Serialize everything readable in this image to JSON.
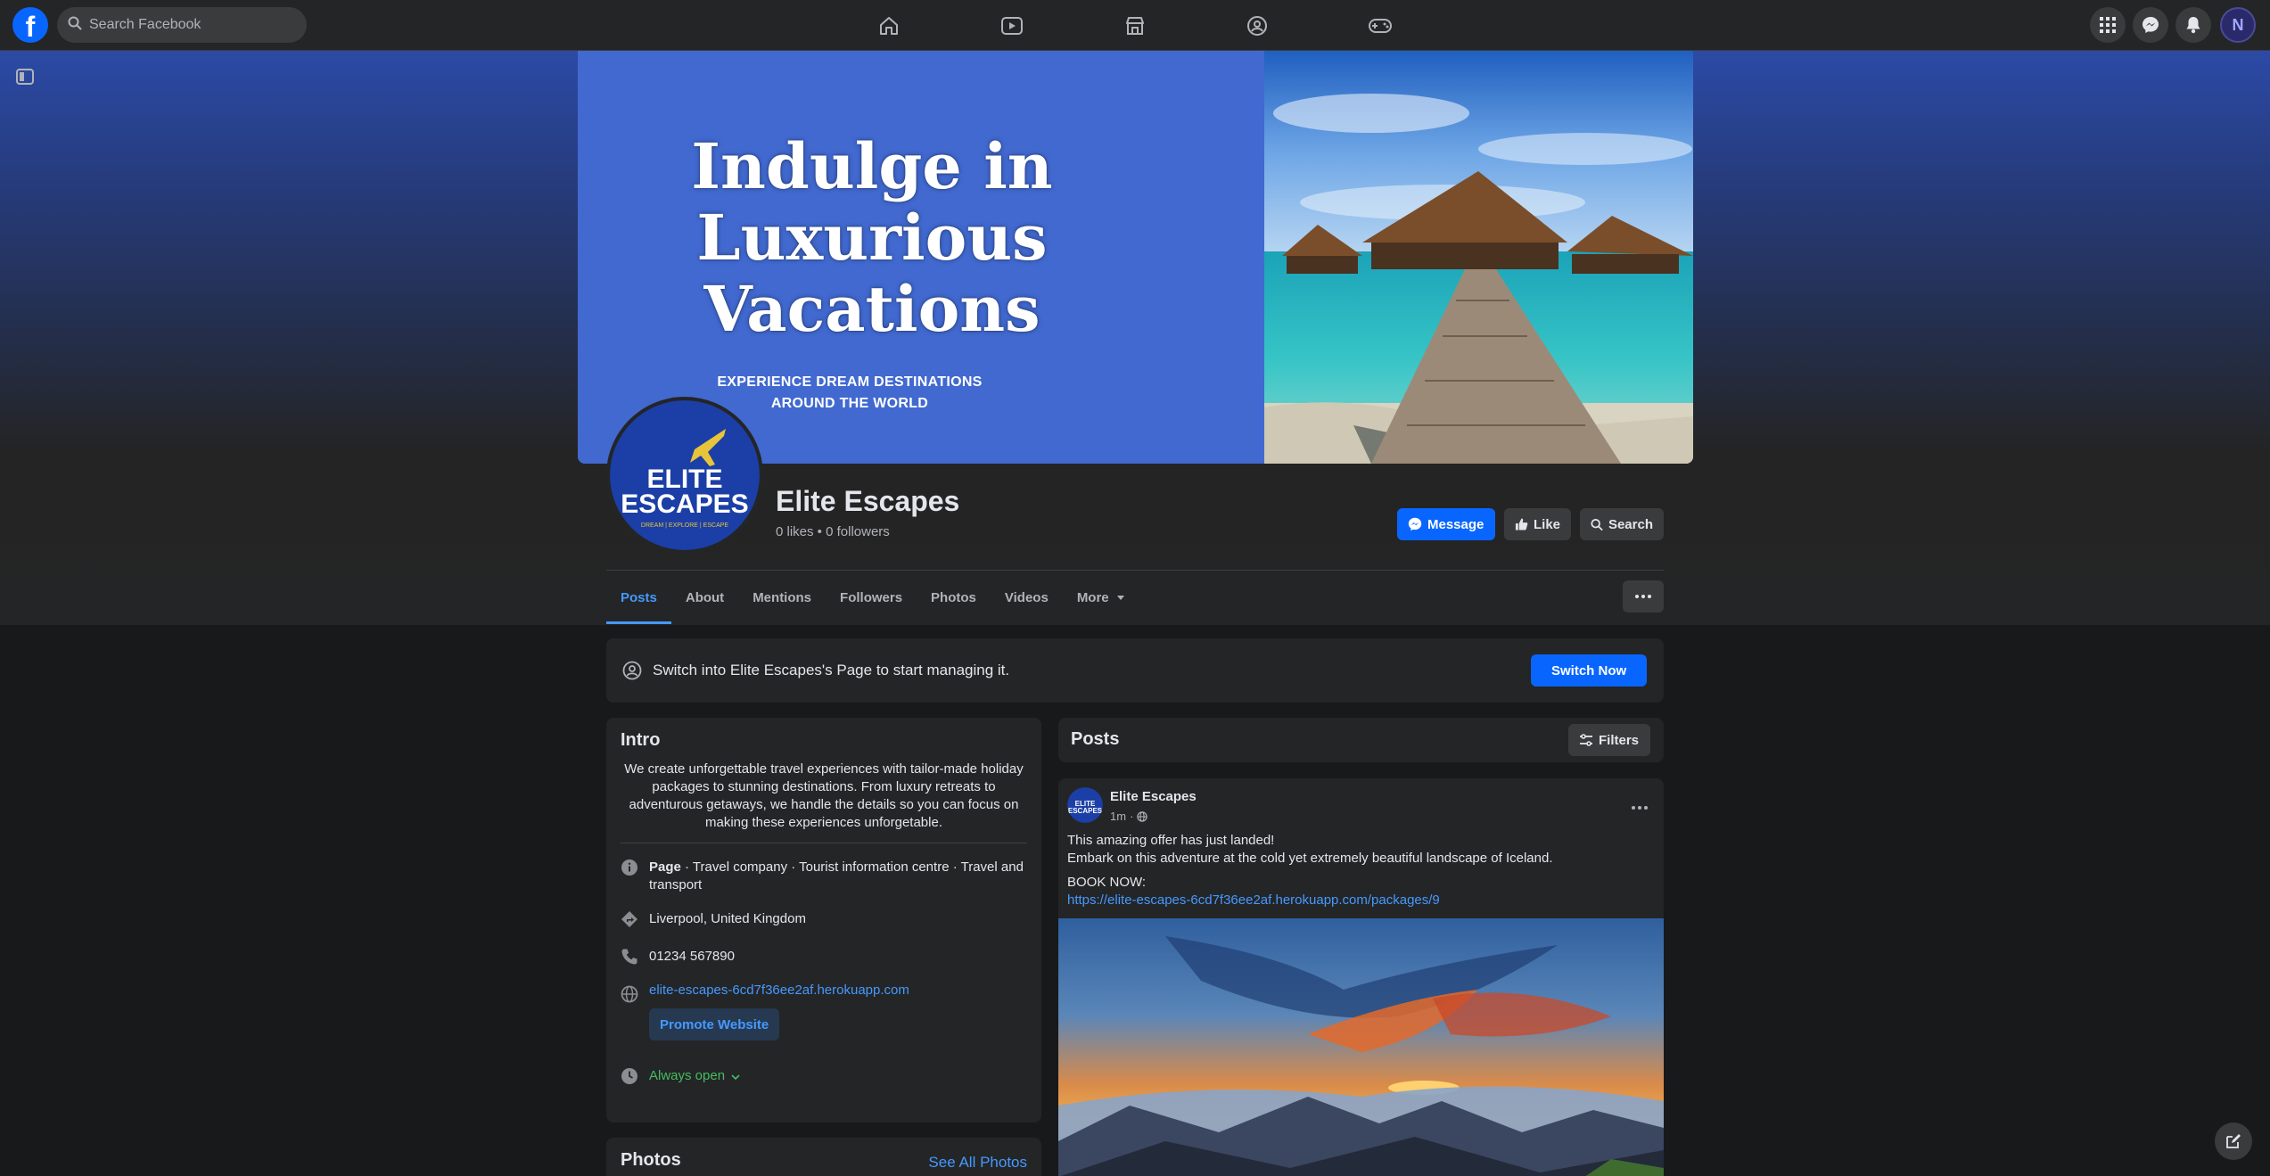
{
  "topbar": {
    "search_placeholder": "Search Facebook",
    "brand_color": "#0866ff",
    "nav_icons": [
      "home-icon",
      "video-icon",
      "marketplace-icon",
      "groups-icon",
      "gaming-icon"
    ],
    "right_icons": [
      "menu-grid-icon",
      "messenger-icon",
      "notifications-icon"
    ],
    "avatar_initial": "N"
  },
  "cover": {
    "headline_line1": "Indulge in",
    "headline_line2": "Luxurious",
    "headline_line3": "Vacations",
    "subline1": "EXPERIENCE DREAM DESTINATIONS",
    "subline2": "AROUND THE WORLD"
  },
  "profile": {
    "logo_line1": "ELITE",
    "logo_line2": "ESCAPES",
    "logo_tagline": "DREAM | EXPLORE | ESCAPE",
    "name": "Elite Escapes",
    "stats": "0 likes • 0 followers",
    "actions": {
      "message": "Message",
      "like": "Like",
      "search": "Search"
    }
  },
  "tabs": [
    "Posts",
    "About",
    "Mentions",
    "Followers",
    "Photos",
    "Videos",
    "More"
  ],
  "switch_banner": {
    "text": "Switch into Elite Escapes's Page to start managing it.",
    "button": "Switch Now"
  },
  "intro": {
    "title": "Intro",
    "bio": "We create unforgettable travel experiences with tailor-made holiday packages to stunning destinations. From luxury retreats to adventurous getaways, we handle the details so you can focus on making these experiences unforgetable.",
    "category_bold": "Page",
    "category_rest": " · Travel company · Tourist information centre · Travel and transport",
    "location": "Liverpool, United Kingdom",
    "phone": "01234 567890",
    "website": "elite-escapes-6cd7f36ee2af.herokuapp.com",
    "promote": "Promote Website",
    "hours": "Always open"
  },
  "photos": {
    "title": "Photos",
    "see_all": "See All Photos"
  },
  "posts": {
    "title": "Posts",
    "filters": "Filters",
    "post": {
      "author": "Elite Escapes",
      "time": "1m",
      "line1": "This amazing offer has just landed!",
      "line2": "Embark on this adventure at the cold yet extremely beautiful landscape of Iceland.",
      "line3": "BOOK NOW:",
      "url": "https://elite-escapes-6cd7f36ee2af.herokuapp.com/packages/9"
    }
  }
}
